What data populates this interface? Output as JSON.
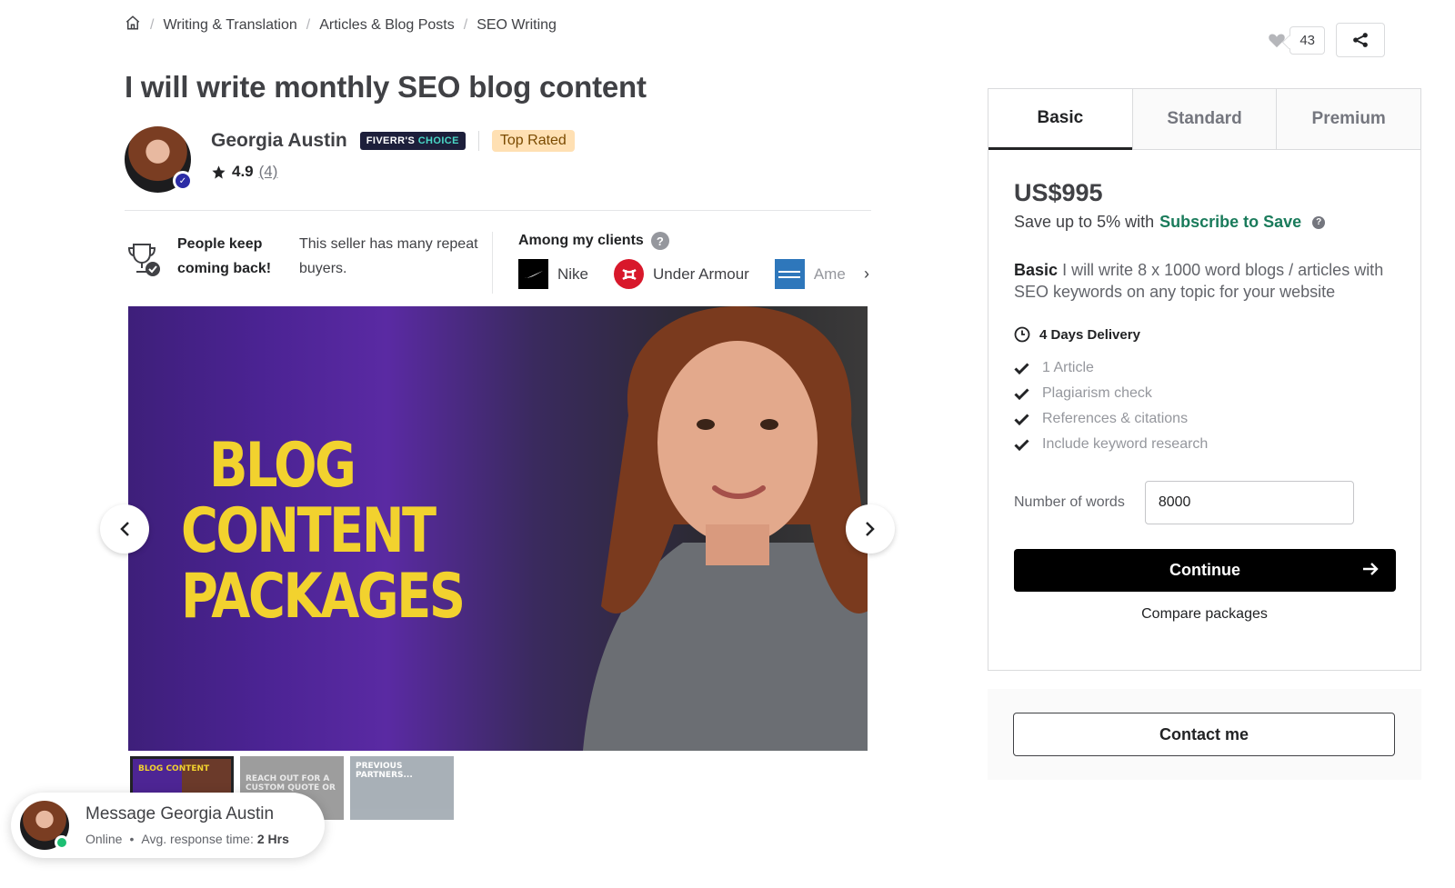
{
  "breadcrumb": {
    "home_icon": "home-icon",
    "items": [
      "Writing & Translation",
      "Articles & Blog Posts",
      "SEO Writing"
    ],
    "separator": "/"
  },
  "actions": {
    "like_count": "43",
    "heart_icon": "heart-icon",
    "share_icon": "share-icon"
  },
  "gig": {
    "title": "I will write monthly SEO blog content"
  },
  "seller": {
    "name": "Georgia Austin",
    "choice_badge_a": "FIVERR'S ",
    "choice_badge_b": "CHOICE",
    "level": "Top Rated",
    "rating": "4.9",
    "reviews": "(4)"
  },
  "trust": {
    "keep_title": "People keep coming back!",
    "keep_desc": "This seller has many repeat buyers.",
    "clients_title": "Among my clients",
    "clients": [
      {
        "name": "Nike"
      },
      {
        "name": "Under Armour"
      },
      {
        "name": "American Express"
      }
    ]
  },
  "gallery": {
    "hero_text": "BLOG CONTENT PACKAGES",
    "thumb1_text": "BLOG CONTENT",
    "thumb2_text": "REACH OUT FOR A CUSTOM QUOTE OR TO WORK",
    "thumb3_text": "PREVIOUS PARTNERS..."
  },
  "message": {
    "title": "Message Georgia Austin",
    "status": "Online",
    "dot": "•",
    "response_label": "Avg. response time:",
    "response_value": "2 Hrs"
  },
  "package": {
    "tabs": [
      "Basic",
      "Standard",
      "Premium"
    ],
    "active_tab": "Basic",
    "price": "US$995",
    "save_prefix": "Save up to 5% with",
    "save_link": "Subscribe to Save",
    "desc_name": "Basic",
    "desc_text": "I will write 8 x 1000 word blogs / articles with SEO keywords on any topic for your website",
    "delivery": "4 Days Delivery",
    "features": [
      "1 Article",
      "Plagiarism check",
      "References & citations",
      "Include keyword research"
    ],
    "words_label": "Number of words",
    "words_value": "8000",
    "continue_label": "Continue",
    "compare_label": "Compare packages",
    "contact_label": "Contact me"
  },
  "colors": {
    "accent_green": "#1dbf73",
    "link_green": "#1a7b5b",
    "hero_yellow": "#f2d22e",
    "hero_purple": "#4b2393"
  }
}
